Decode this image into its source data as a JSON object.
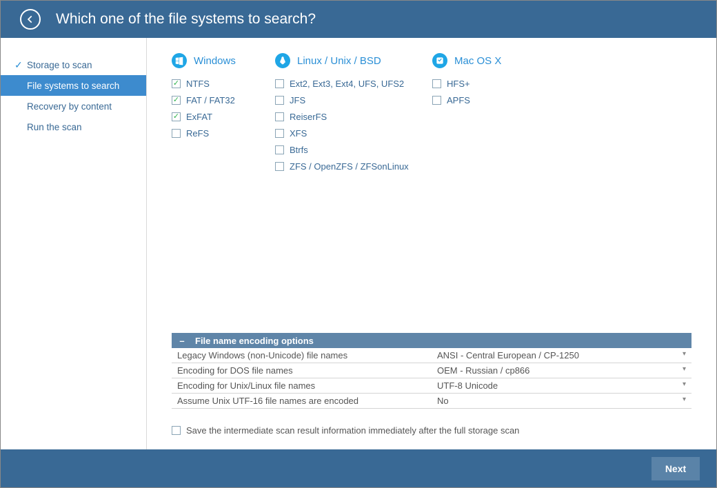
{
  "header": {
    "title": "Which one of the file systems to search?"
  },
  "sidebar": {
    "items": [
      {
        "label": "Storage to scan",
        "completed": true,
        "active": false
      },
      {
        "label": "File systems to search",
        "completed": false,
        "active": true
      },
      {
        "label": "Recovery by content",
        "completed": false,
        "active": false
      },
      {
        "label": "Run the scan",
        "completed": false,
        "active": false
      }
    ]
  },
  "fs_groups": [
    {
      "name": "Windows",
      "icon": "windows",
      "wide": false,
      "items": [
        {
          "label": "NTFS",
          "checked": true
        },
        {
          "label": "FAT / FAT32",
          "checked": true
        },
        {
          "label": "ExFAT",
          "checked": true
        },
        {
          "label": "ReFS",
          "checked": false
        }
      ]
    },
    {
      "name": "Linux / Unix / BSD",
      "icon": "linux",
      "wide": true,
      "items": [
        {
          "label": "Ext2, Ext3, Ext4, UFS, UFS2",
          "checked": false
        },
        {
          "label": "JFS",
          "checked": false
        },
        {
          "label": "ReiserFS",
          "checked": false
        },
        {
          "label": "XFS",
          "checked": false
        },
        {
          "label": "Btrfs",
          "checked": false
        },
        {
          "label": "ZFS / OpenZFS / ZFSonLinux",
          "checked": false
        }
      ]
    },
    {
      "name": "Mac OS X",
      "icon": "mac",
      "wide": false,
      "items": [
        {
          "label": "HFS+",
          "checked": false
        },
        {
          "label": "APFS",
          "checked": false
        }
      ]
    }
  ],
  "encoding": {
    "title": "File name encoding options",
    "rows": [
      {
        "label": "Legacy Windows (non-Unicode) file names",
        "value": "ANSI - Central European / CP-1250"
      },
      {
        "label": "Encoding for DOS file names",
        "value": "OEM - Russian / cp866"
      },
      {
        "label": "Encoding for Unix/Linux file names",
        "value": "UTF-8 Unicode"
      },
      {
        "label": "Assume Unix UTF-16 file names are encoded",
        "value": "No"
      }
    ]
  },
  "save_intermediate": {
    "label": "Save the intermediate scan result information immediately after the full storage scan",
    "checked": false
  },
  "footer": {
    "next": "Next"
  }
}
